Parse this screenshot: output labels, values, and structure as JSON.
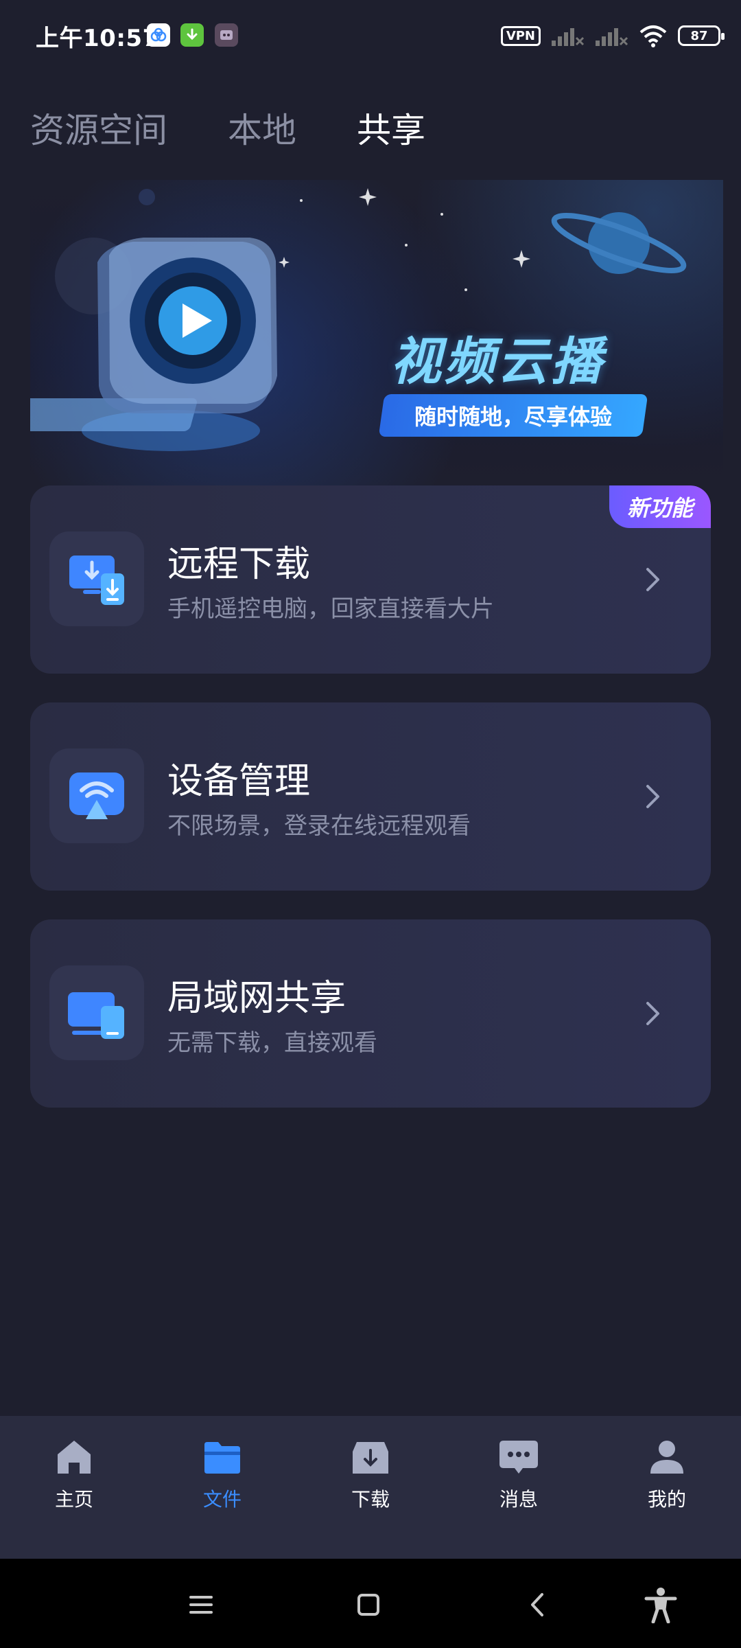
{
  "status_bar": {
    "time": "上午10:57",
    "vpn": "VPN",
    "battery": "87"
  },
  "tabs": [
    {
      "label": "资源空间",
      "active": false
    },
    {
      "label": "本地",
      "active": false
    },
    {
      "label": "共享",
      "active": true
    }
  ],
  "banner": {
    "title": "视频云播",
    "subtitle": "随时随地，尽享体验"
  },
  "cards": [
    {
      "title": "远程下载",
      "desc": "手机遥控电脑，回家直接看大片",
      "badge": "新功能",
      "icon": "remote-download-icon"
    },
    {
      "title": "设备管理",
      "desc": "不限场景，登录在线远程观看",
      "icon": "device-cast-icon"
    },
    {
      "title": "局域网共享",
      "desc": "无需下载，直接观看",
      "icon": "lan-share-icon"
    }
  ],
  "bottom_nav": [
    {
      "label": "主页",
      "icon": "home-icon",
      "active": false
    },
    {
      "label": "文件",
      "icon": "folder-icon",
      "active": true
    },
    {
      "label": "下载",
      "icon": "download-box-icon",
      "active": false
    },
    {
      "label": "消息",
      "icon": "message-icon",
      "active": false
    },
    {
      "label": "我的",
      "icon": "user-icon",
      "active": false
    }
  ],
  "colors": {
    "background": "#1e1f2e",
    "card": "#2a2c43",
    "accent": "#3a8dff",
    "badge": "#7b5bff"
  }
}
